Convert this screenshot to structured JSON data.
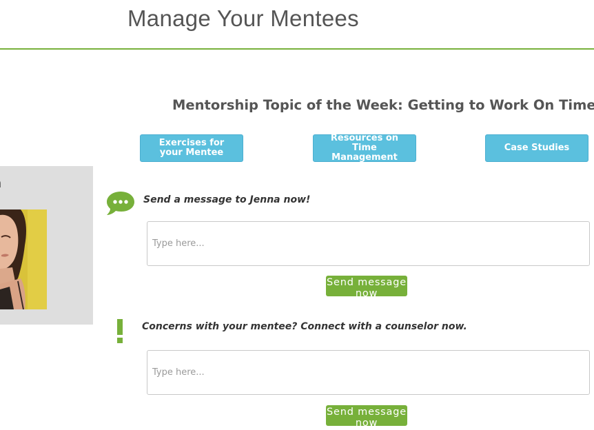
{
  "header": {
    "title": "Manage Your Mentees"
  },
  "topic": {
    "heading": "Mentorship Topic of the Week: Getting to Work On Time",
    "buttons": {
      "exercises": "Exercises for your Mentee",
      "resources": "Resources on Time Management",
      "case_studies": "Case Studies"
    }
  },
  "mentee": {
    "name_visible": "na"
  },
  "message_section": {
    "label": "Send a message to Jenna now!",
    "placeholder": "Type here...",
    "send_label": "Send message now",
    "icon": "speech-bubble-icon"
  },
  "concern_section": {
    "label": "Concerns with your mentee? Connect with a counselor now.",
    "placeholder": "Type here...",
    "send_label": "Send message now",
    "icon": "exclamation-icon"
  },
  "colors": {
    "brand_green": "#77b03a",
    "button_blue": "#5bc0de",
    "card_gray": "#dedede",
    "text_gray": "#555555"
  }
}
